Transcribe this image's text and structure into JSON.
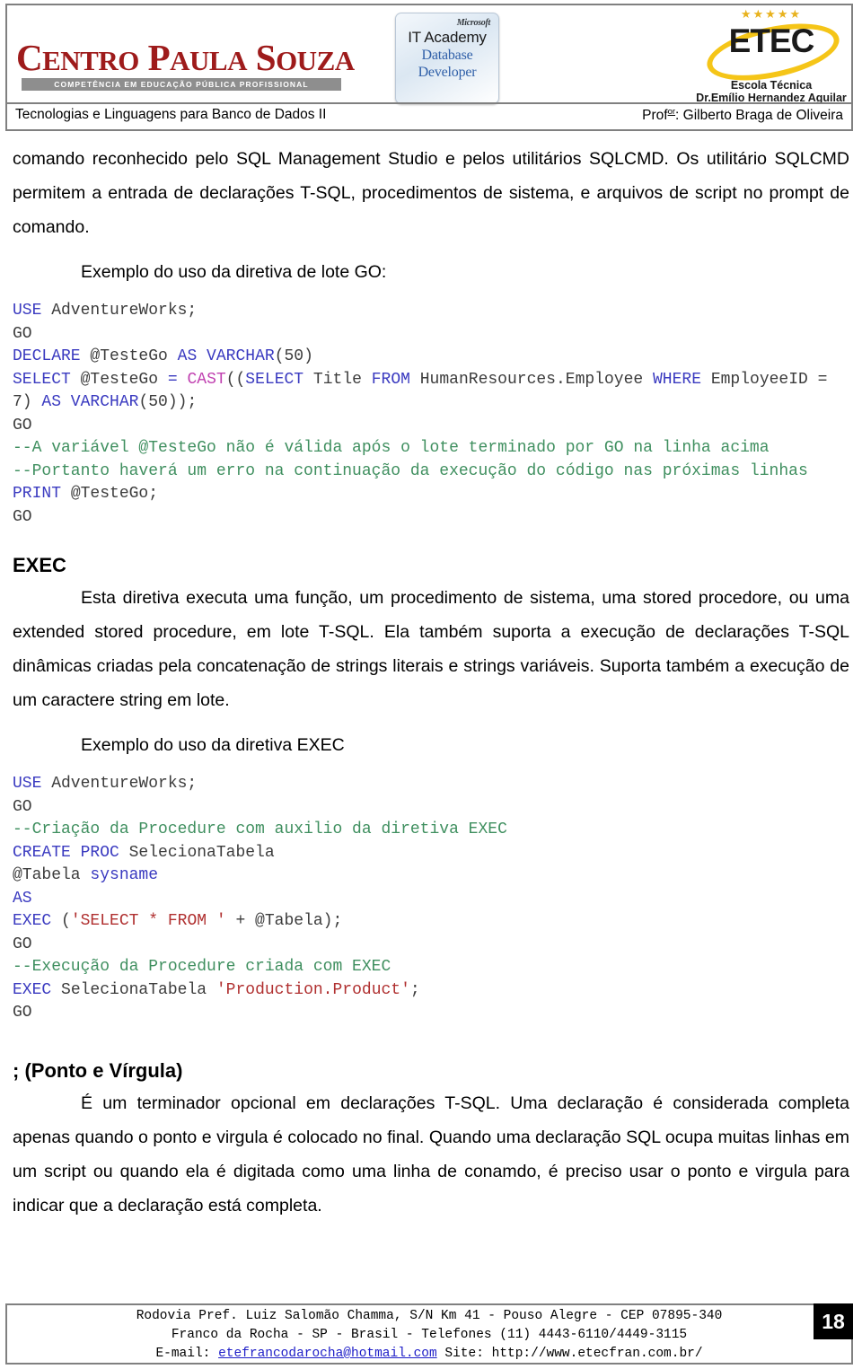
{
  "header": {
    "cps_logo": {
      "line1_parts": [
        "C",
        "entro ",
        "P",
        "aula ",
        "S",
        "ouza"
      ],
      "word_full": "CENTRO PAULA SOUZA",
      "tagline": "COMPETÊNCIA EM EDUCAÇÃO PÚBLICA PROFISSIONAL"
    },
    "ms_badge": {
      "brand": "Microsoft",
      "program": "IT Academy",
      "track_line1": "Database",
      "track_line2": "Developer"
    },
    "etec_logo": {
      "stars": "★★★★★",
      "wordmark": "ETEC",
      "subtitle1": "Escola Técnica",
      "subtitle2": "Dr.Emílio Hernandez Aguilar"
    },
    "course_title": "Tecnologias e Linguagens para Banco de Dados II",
    "professor_prefix": "Prof",
    "professor_superscript": "or",
    "professor_name": ": Gilberto Braga de Oliveira"
  },
  "body": {
    "intro_paragraph": "comando reconhecido pelo SQL Management Studio e pelos utilitários SQLCMD. Os utilitário SQLCMD permitem a entrada de declarações T-SQL, procedimentos de sistema, e arquivos de script no prompt de comando.",
    "example_go_label": "Exemplo do uso da diretiva de lote GO:",
    "code_go": [
      [
        {
          "t": "USE",
          "c": "kw"
        },
        {
          "t": " AdventureWorks;",
          "c": "pl"
        }
      ],
      [
        {
          "t": "GO",
          "c": "pl"
        }
      ],
      [
        {
          "t": "DECLARE",
          "c": "kw"
        },
        {
          "t": " @TesteGo ",
          "c": "pl"
        },
        {
          "t": "AS VARCHAR",
          "c": "kw"
        },
        {
          "t": "(50)",
          "c": "pl"
        }
      ],
      [
        {
          "t": "SELECT",
          "c": "kw"
        },
        {
          "t": " @TesteGo ",
          "c": "pl"
        },
        {
          "t": "=",
          "c": "kw"
        },
        {
          "t": " ",
          "c": "pl"
        },
        {
          "t": "CAST",
          "c": "fn"
        },
        {
          "t": "((",
          "c": "pl"
        },
        {
          "t": "SELECT",
          "c": "kw"
        },
        {
          "t": " Title ",
          "c": "pl"
        },
        {
          "t": "FROM",
          "c": "kw"
        },
        {
          "t": " HumanResources.Employee ",
          "c": "pl"
        },
        {
          "t": "WHERE",
          "c": "kw"
        },
        {
          "t": " EmployeeID = 7) ",
          "c": "pl"
        },
        {
          "t": "AS VARCHAR",
          "c": "kw"
        },
        {
          "t": "(50));",
          "c": "pl"
        }
      ],
      [
        {
          "t": "GO",
          "c": "pl"
        }
      ],
      [
        {
          "t": "--A variável @TesteGo não é válida após o lote terminado por GO na linha acima",
          "c": "cm"
        }
      ],
      [
        {
          "t": "--Portanto haverá um erro na continuação da execução do código nas próximas linhas",
          "c": "cm"
        }
      ],
      [
        {
          "t": "PRINT",
          "c": "kw"
        },
        {
          "t": " @TesteGo;",
          "c": "pl"
        }
      ],
      [
        {
          "t": "GO",
          "c": "pl"
        }
      ]
    ],
    "exec_heading": "EXEC",
    "exec_paragraph": "Esta diretiva executa uma função, um procedimento de sistema, uma stored procedore, ou uma extended stored procedure, em lote T-SQL. Ela também suporta a execução de declarações T-SQL dinâmicas criadas pela concatenação de strings literais e strings variáveis. Suporta também a execução de um caractere string em lote.",
    "example_exec_label": "Exemplo do uso da diretiva EXEC",
    "code_exec": [
      [
        {
          "t": "USE",
          "c": "kw"
        },
        {
          "t": " AdventureWorks;",
          "c": "pl"
        }
      ],
      [
        {
          "t": "GO",
          "c": "pl"
        }
      ],
      [
        {
          "t": "--Criação da Procedure com auxilio da diretiva EXEC",
          "c": "cm"
        }
      ],
      [
        {
          "t": "CREATE PROC",
          "c": "kw"
        },
        {
          "t": " SelecionaTabela",
          "c": "pl"
        }
      ],
      [
        {
          "t": "@Tabela ",
          "c": "pl"
        },
        {
          "t": "sysname",
          "c": "kw"
        }
      ],
      [
        {
          "t": "AS",
          "c": "kw"
        }
      ],
      [
        {
          "t": "EXEC",
          "c": "kw"
        },
        {
          "t": " (",
          "c": "pl"
        },
        {
          "t": "'SELECT * FROM '",
          "c": "str"
        },
        {
          "t": " + @Tabela);",
          "c": "pl"
        }
      ],
      [
        {
          "t": "GO",
          "c": "pl"
        }
      ],
      [
        {
          "t": "--Execução da Procedure criada com EXEC",
          "c": "cm"
        }
      ],
      [
        {
          "t": "EXEC",
          "c": "kw"
        },
        {
          "t": " SelecionaTabela ",
          "c": "pl"
        },
        {
          "t": "'Production.Product'",
          "c": "str"
        },
        {
          "t": ";",
          "c": "pl"
        }
      ],
      [
        {
          "t": "GO",
          "c": "pl"
        }
      ]
    ],
    "semicolon_heading": "; (Ponto e Vírgula)",
    "semicolon_paragraph": "É um terminador opcional em declarações T-SQL. Uma declaração é considerada completa apenas quando o ponto e virgula é colocado no final. Quando uma declaração SQL ocupa muitas linhas em um script ou quando ela é digitada como uma linha de conamdo, é preciso usar o ponto e virgula para indicar que a declaração está completa."
  },
  "footer": {
    "line1": "Rodovia Pref. Luiz Salomão Chamma, S/N Km 41 - Pouso Alegre - CEP 07895-340",
    "line2": "Franco da Rocha - SP - Brasil - Telefones (11) 4443-6110/4449-3115",
    "line3_prefix": "E-mail: ",
    "line3_email": "etefrancodarocha@hotmail.com",
    "line3_suffix": " Site: http://www.etecfran.com.br/",
    "page_number": "18"
  },
  "colors": {
    "keyword": "#3a3ac0",
    "comment": "#3f8f5f",
    "function": "#c040b0",
    "string": "#b03030",
    "plain": "#3c3c3c",
    "logo_red": "#9e1b1b",
    "etec_gold": "#f5c518"
  }
}
